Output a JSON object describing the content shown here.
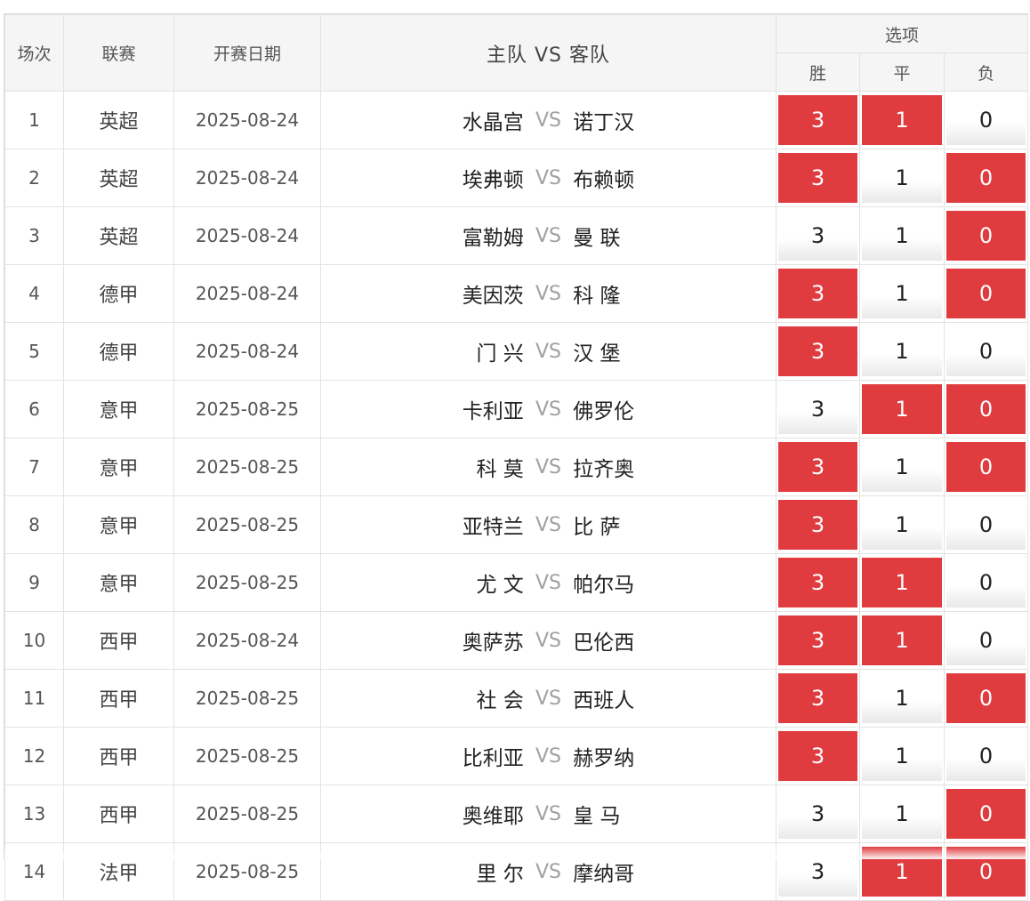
{
  "header": {
    "index": "场次",
    "league": "联赛",
    "date": "开赛日期",
    "home_label": "主队",
    "vs_label": "VS",
    "away_label": "客队",
    "options": "选项",
    "win": "胜",
    "draw": "平",
    "lose": "负"
  },
  "colors": {
    "selected": "#e03b3f",
    "vs_text": "#a0a0a0"
  },
  "rows": [
    {
      "num": "1",
      "league": "英超",
      "date": "2025-08-24",
      "home": "水晶宫",
      "vs": "VS",
      "away": "诺丁汉",
      "win": "3",
      "draw": "1",
      "lose": "0",
      "win_sel": true,
      "draw_sel": true,
      "lose_sel": false
    },
    {
      "num": "2",
      "league": "英超",
      "date": "2025-08-24",
      "home": "埃弗顿",
      "vs": "VS",
      "away": "布赖顿",
      "win": "3",
      "draw": "1",
      "lose": "0",
      "win_sel": true,
      "draw_sel": false,
      "lose_sel": true
    },
    {
      "num": "3",
      "league": "英超",
      "date": "2025-08-24",
      "home": "富勒姆",
      "vs": "VS",
      "away": "曼 联",
      "win": "3",
      "draw": "1",
      "lose": "0",
      "win_sel": false,
      "draw_sel": false,
      "lose_sel": true
    },
    {
      "num": "4",
      "league": "德甲",
      "date": "2025-08-24",
      "home": "美因茨",
      "vs": "VS",
      "away": "科 隆",
      "win": "3",
      "draw": "1",
      "lose": "0",
      "win_sel": true,
      "draw_sel": false,
      "lose_sel": true
    },
    {
      "num": "5",
      "league": "德甲",
      "date": "2025-08-24",
      "home": "门 兴",
      "vs": "VS",
      "away": "汉 堡",
      "win": "3",
      "draw": "1",
      "lose": "0",
      "win_sel": true,
      "draw_sel": false,
      "lose_sel": false
    },
    {
      "num": "6",
      "league": "意甲",
      "date": "2025-08-25",
      "home": "卡利亚",
      "vs": "VS",
      "away": "佛罗伦",
      "win": "3",
      "draw": "1",
      "lose": "0",
      "win_sel": false,
      "draw_sel": true,
      "lose_sel": true
    },
    {
      "num": "7",
      "league": "意甲",
      "date": "2025-08-25",
      "home": "科 莫",
      "vs": "VS",
      "away": "拉齐奥",
      "win": "3",
      "draw": "1",
      "lose": "0",
      "win_sel": true,
      "draw_sel": false,
      "lose_sel": true
    },
    {
      "num": "8",
      "league": "意甲",
      "date": "2025-08-25",
      "home": "亚特兰",
      "vs": "VS",
      "away": "比 萨",
      "win": "3",
      "draw": "1",
      "lose": "0",
      "win_sel": true,
      "draw_sel": false,
      "lose_sel": false
    },
    {
      "num": "9",
      "league": "意甲",
      "date": "2025-08-25",
      "home": "尤 文",
      "vs": "VS",
      "away": "帕尔马",
      "win": "3",
      "draw": "1",
      "lose": "0",
      "win_sel": true,
      "draw_sel": true,
      "lose_sel": false
    },
    {
      "num": "10",
      "league": "西甲",
      "date": "2025-08-24",
      "home": "奥萨苏",
      "vs": "VS",
      "away": "巴伦西",
      "win": "3",
      "draw": "1",
      "lose": "0",
      "win_sel": true,
      "draw_sel": true,
      "lose_sel": false
    },
    {
      "num": "11",
      "league": "西甲",
      "date": "2025-08-25",
      "home": "社 会",
      "vs": "VS",
      "away": "西班人",
      "win": "3",
      "draw": "1",
      "lose": "0",
      "win_sel": true,
      "draw_sel": false,
      "lose_sel": true
    },
    {
      "num": "12",
      "league": "西甲",
      "date": "2025-08-25",
      "home": "比利亚",
      "vs": "VS",
      "away": "赫罗纳",
      "win": "3",
      "draw": "1",
      "lose": "0",
      "win_sel": true,
      "draw_sel": false,
      "lose_sel": false
    },
    {
      "num": "13",
      "league": "西甲",
      "date": "2025-08-25",
      "home": "奥维耶",
      "vs": "VS",
      "away": "皇 马",
      "win": "3",
      "draw": "1",
      "lose": "0",
      "win_sel": false,
      "draw_sel": false,
      "lose_sel": true
    },
    {
      "num": "14",
      "league": "法甲",
      "date": "2025-08-25",
      "home": "里 尔",
      "vs": "VS",
      "away": "摩纳哥",
      "win": "3",
      "draw": "1",
      "lose": "0",
      "win_sel": false,
      "draw_sel": true,
      "lose_sel": true
    }
  ]
}
